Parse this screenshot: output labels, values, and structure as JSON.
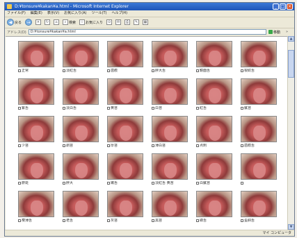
{
  "window": {
    "title": "D:¥tonsure¥kakan¥a.html - Microsoft Internet Explorer",
    "min": "_",
    "max": "□",
    "close": "×"
  },
  "menu": [
    "ファイル(F)",
    "編集(E)",
    "表示(V)",
    "お気に入り(A)",
    "ツール(T)",
    "ヘルプ(H)"
  ],
  "toolbar": {
    "back": "戻る",
    "forward": "→",
    "stop": "×",
    "refresh": "↻",
    "home": "⌂",
    "search": "検索",
    "favorites": "お気に入り",
    "history": "⊙",
    "mail": "✉",
    "print": "⎙",
    "edit": "✎",
    "messenger": "▦"
  },
  "address": {
    "label": "アドレス(D)",
    "value": "D:¥tonsure¥kakan¥a.html",
    "go": "移動",
    "links": "»"
  },
  "items": [
    [
      "正常",
      "淡紅舌",
      "歯痕",
      "胖大舌",
      "鏡面舌",
      "裂紋舌"
    ],
    [
      "紫舌",
      "淡白舌",
      "黄苔",
      "白苔",
      "紅舌",
      "膩苔"
    ],
    [
      "少苔",
      "剥苔",
      "厚苔",
      "薄白苔",
      "点刺",
      "歯痕舌"
    ],
    [
      "瘀斑",
      "胖大",
      "嫩舌",
      "淡紅舌 黄苔",
      "白膩苔",
      ""
    ],
    [
      "痩薄舌",
      "老舌",
      "灰苔",
      "黒苔",
      "絳舌",
      "歪斜舌"
    ]
  ],
  "status": {
    "left": "",
    "right": "マイ コンピュータ"
  },
  "scroll": {
    "up": "▲",
    "down": "▼"
  }
}
